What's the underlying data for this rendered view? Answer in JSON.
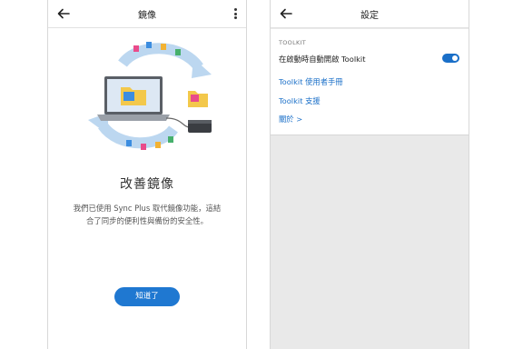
{
  "left_screen": {
    "title": "鏡像",
    "heading": "改善鏡像",
    "description": "我們已使用 Sync Plus 取代鏡像功能，這結合了同步的便利性與備份的安全性。",
    "button_label": "知道了"
  },
  "right_screen": {
    "title": "設定",
    "section_label": "TOOLKIT",
    "toggle_row_label": "在啟動時自動開啟 Toolkit",
    "toggle_on": true,
    "links": [
      "Toolkit 使用者手冊",
      "Toolkit 支援",
      "關於 >"
    ]
  },
  "colors": {
    "accent": "#1f78d1",
    "link": "#1a6fc8",
    "settings_background": "#e9e9e9"
  }
}
